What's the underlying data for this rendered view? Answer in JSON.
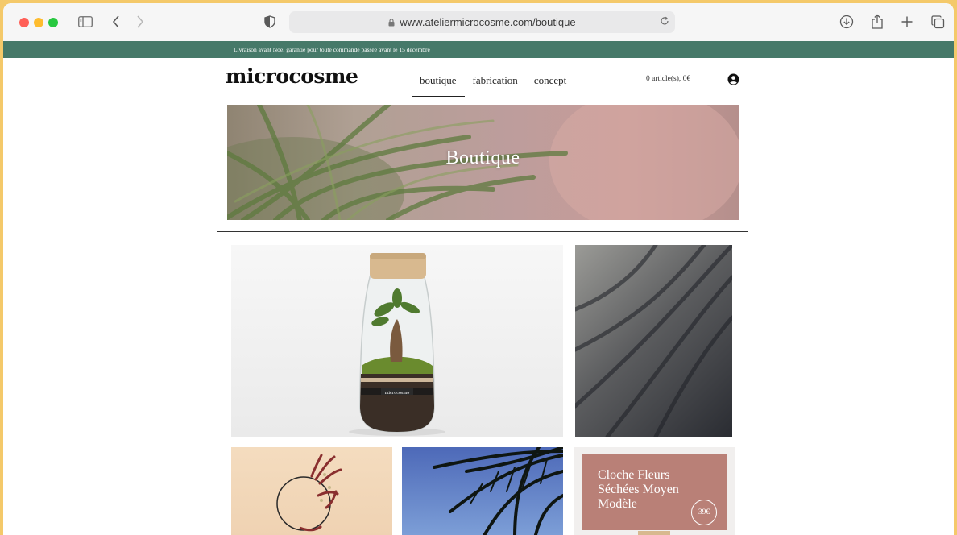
{
  "browser": {
    "url": "www.ateliermicrocosme.com/boutique"
  },
  "announcement": {
    "text": "Livraison avant Noël garantie pour toute commande passée avant le 15 décembre",
    "background": "#467969"
  },
  "header": {
    "logo": "microcosme",
    "nav": [
      {
        "label": "boutique",
        "active": true
      },
      {
        "label": "fabrication",
        "active": false
      },
      {
        "label": "concept",
        "active": false
      }
    ],
    "cart": "0 article(s), 0€"
  },
  "hero": {
    "title": "Boutique"
  },
  "products": [
    {
      "image": "terrarium-with-bonsai",
      "logo_text": "microcosme"
    },
    {
      "image": "palm-shadow-on-wall"
    },
    {
      "image": "dried-flower-wreath"
    },
    {
      "image": "palm-leaves-blue-sky"
    },
    {
      "image": "dried-flower-cloche",
      "title": "Cloche Fleurs Séchées Moyen Modèle",
      "price": "39€",
      "card_color": "#b98077"
    }
  ]
}
